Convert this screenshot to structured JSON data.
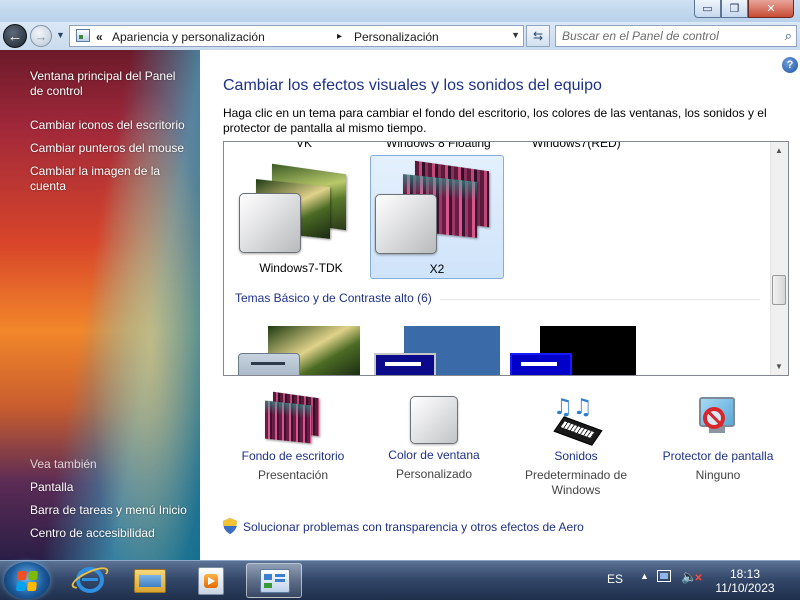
{
  "window": {
    "caption": {
      "minimize": "▭",
      "maximize": "❐",
      "close": "✕"
    }
  },
  "navigation": {
    "back": "←",
    "forward": "→",
    "breadcrumb_prefix": "«",
    "breadcrumbs": [
      "Apariencia y personalización",
      "Personalización"
    ],
    "separator": "▸",
    "search_placeholder": "Buscar en el Panel de control"
  },
  "sidebar": {
    "links": [
      "Ventana principal del Panel de control",
      "Cambiar iconos del escritorio",
      "Cambiar punteros del mouse",
      "Cambiar la imagen de la cuenta"
    ],
    "see_also_title": "Vea también",
    "see_also": [
      "Pantalla",
      "Barra de tareas y menú Inicio",
      "Centro de accesibilidad"
    ]
  },
  "main": {
    "title": "Cambiar los efectos visuales y los sonidos del equipo",
    "description": "Haga clic en un tema para cambiar el fondo del escritorio, los colores de las ventanas, los sonidos y el protector de pantalla al mismo tiempo.",
    "partial_labels": [
      "VK",
      "Windows 8 Floating",
      "Windows7(RED)"
    ],
    "themes": [
      {
        "name": "Windows7-TDK",
        "selected": false
      },
      {
        "name": "X2",
        "selected": true
      }
    ],
    "basic_group_title": "Temas Básico y de Contraste alto (6)",
    "scroll_position": 0.68
  },
  "settings": [
    {
      "label": "Fondo de escritorio",
      "value": "Presentación"
    },
    {
      "label": "Color de ventana",
      "value": "Personalizado"
    },
    {
      "label": "Sonidos",
      "value": "Predeterminado de Windows"
    },
    {
      "label": "Protector de pantalla",
      "value": "Ninguno"
    }
  ],
  "troubleshoot_link": "Solucionar problemas con transparencia y otros efectos de Aero",
  "taskbar": {
    "language": "ES",
    "time": "18:13",
    "date": "11/10/2023"
  },
  "colors": {
    "link": "#1e3287",
    "selected_tile": "#cfe3fa",
    "taskbar": "#34486a"
  }
}
